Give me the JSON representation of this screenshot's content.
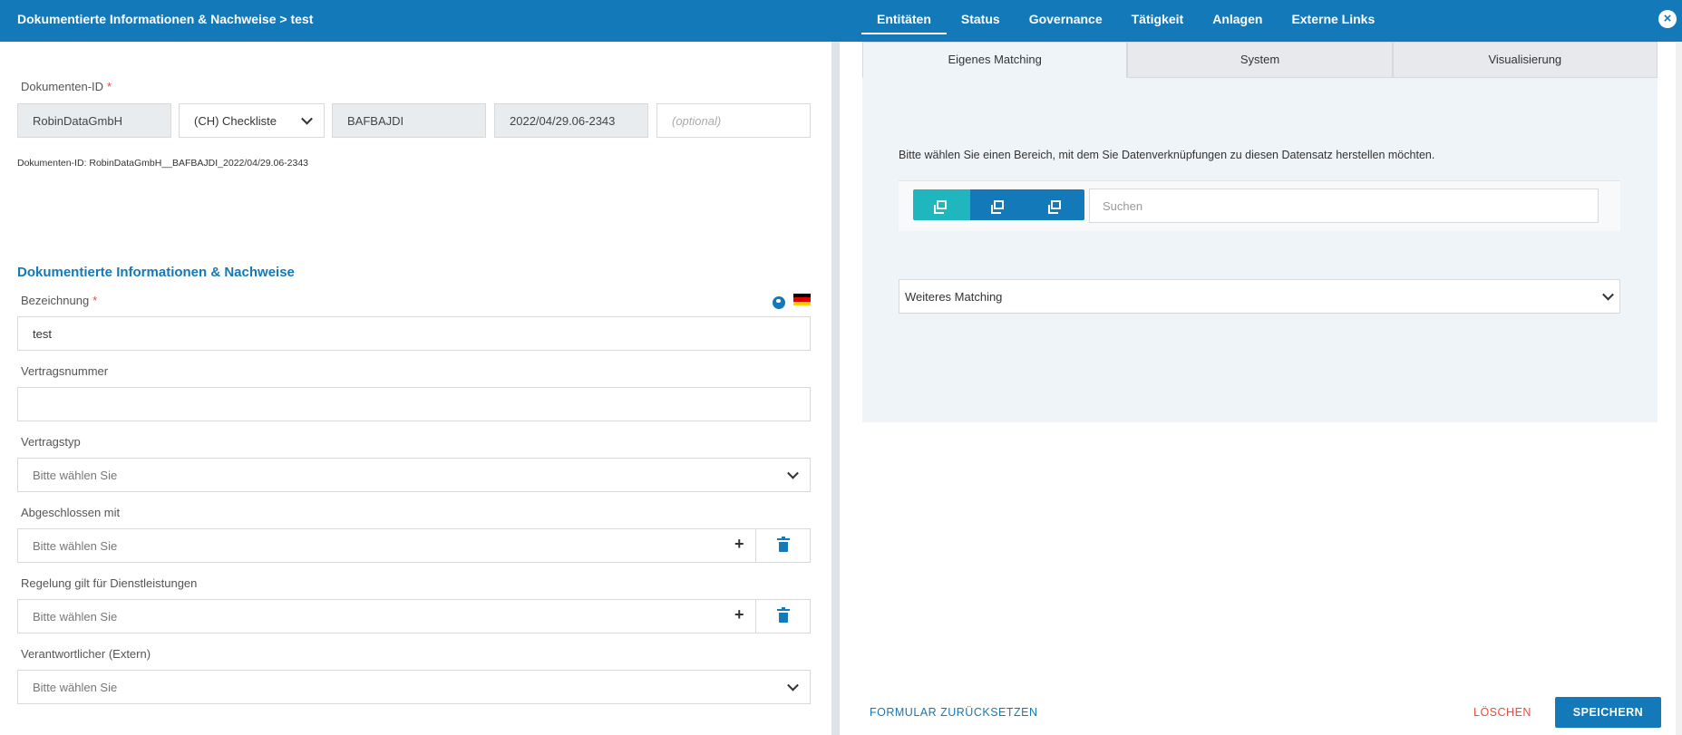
{
  "header": {
    "breadcrumb": "Dokumentierte Informationen & Nachweise > test",
    "nav": [
      "Entitäten",
      "Status",
      "Governance",
      "Tätigkeit",
      "Anlagen",
      "Externe Links"
    ],
    "close_label": "×"
  },
  "left": {
    "doc_id": {
      "label": "Dokumenten-ID",
      "required_mark": "*",
      "company": "RobinDataGmbH",
      "type": "(CH) Checkliste",
      "code": "BAFBAJDI",
      "stamp": "2022/04/29.06-2343",
      "optional_placeholder": "(optional)",
      "summary": "Dokumenten-ID: RobinDataGmbH__BAFBAJDI_2022/04/29.06-2343"
    },
    "section_title": "Dokumentierte Informationen & Nachweise",
    "fields": {
      "bezeichnung_label": "Bezeichnung",
      "bezeichnung_value": "test",
      "vertragsnummer_label": "Vertragsnummer",
      "vertragsnummer_value": "",
      "vertragstyp_label": "Vertragstyp",
      "vertragstyp_value": "Bitte wählen Sie",
      "abgeschlossen_label": "Abgeschlossen mit",
      "abgeschlossen_value": "Bitte wählen Sie",
      "regelung_label": "Regelung gilt für Dienstleistungen",
      "regelung_value": "Bitte wählen Sie",
      "verantwortlicher_label": "Verantwortlicher (Extern)",
      "verantwortlicher_value": "Bitte wählen Sie",
      "plus": "+"
    }
  },
  "right": {
    "tabs": [
      "Eigenes Matching",
      "System",
      "Visualisierung"
    ],
    "instruction": "Bitte wählen Sie einen Bereich, mit dem Sie Datenverknüpfungen zu diesen Datensatz herstellen möchten.",
    "search_placeholder": "Suchen",
    "more_matching": "Weiteres Matching"
  },
  "footer": {
    "reset": "FORMULAR ZURÜCKSETZEN",
    "delete": "LÖSCHEN",
    "save": "SPEICHERN"
  },
  "colors": {
    "primary": "#1479b8",
    "teal": "#1fb6be",
    "danger": "#e74c3c"
  }
}
